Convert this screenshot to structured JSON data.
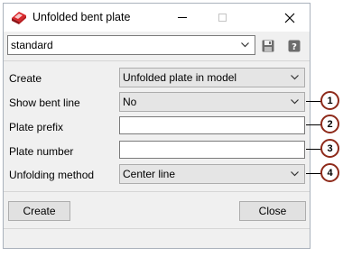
{
  "window": {
    "title": "Unfolded bent plate"
  },
  "preset": {
    "value": "standard"
  },
  "form": {
    "rows": [
      {
        "label": "Create",
        "value": "Unfolded plate in model"
      },
      {
        "label": "Show bent line",
        "value": "No"
      },
      {
        "label": "Plate prefix",
        "value": ""
      },
      {
        "label": "Plate number",
        "value": ""
      },
      {
        "label": "Unfolding method",
        "value": "Center line"
      }
    ]
  },
  "buttons": {
    "create": "Create",
    "close": "Close"
  },
  "callouts": [
    "1",
    "2",
    "3",
    "4"
  ],
  "icons": {
    "app": "red-plate-icon",
    "save": "floppy-disk-icon",
    "help": "help-icon"
  },
  "colors": {
    "callout_border": "#8e2a1a",
    "dialog_bg": "#f0f0f0",
    "dropdown_bg": "#e5e5e5"
  }
}
